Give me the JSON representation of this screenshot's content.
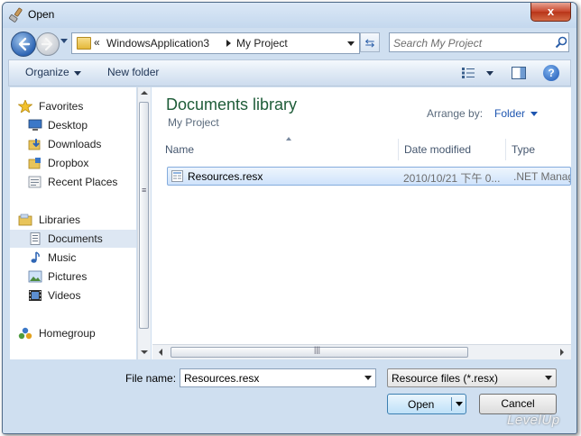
{
  "window": {
    "title": "Open",
    "close_label": "x"
  },
  "navigation": {
    "breadcrumb_prefix": "«",
    "path": [
      "WindowsApplication3",
      "My Project"
    ],
    "refresh_glyph": "⇆",
    "search_placeholder": "Search My Project"
  },
  "toolbar": {
    "organize_label": "Organize",
    "new_folder_label": "New folder"
  },
  "sidebar": {
    "favorites_label": "Favorites",
    "favorites": [
      {
        "label": "Desktop",
        "icon": "desktop-icon"
      },
      {
        "label": "Downloads",
        "icon": "downloads-icon"
      },
      {
        "label": "Dropbox",
        "icon": "dropbox-icon"
      },
      {
        "label": "Recent Places",
        "icon": "recent-places-icon"
      }
    ],
    "libraries_label": "Libraries",
    "libraries": [
      {
        "label": "Documents",
        "icon": "documents-icon",
        "selected": true
      },
      {
        "label": "Music",
        "icon": "music-icon"
      },
      {
        "label": "Pictures",
        "icon": "pictures-icon"
      },
      {
        "label": "Videos",
        "icon": "videos-icon"
      }
    ],
    "homegroup_label": "Homegroup"
  },
  "content": {
    "library_title": "Documents library",
    "library_subtitle": "My Project",
    "arrange_by_label": "Arrange by:",
    "arrange_by_value": "Folder",
    "columns": [
      "Name",
      "Date modified",
      "Type"
    ],
    "files": [
      {
        "name": "Resources.resx",
        "date_modified": "2010/10/21 下午 0...",
        "type": ".NET Manag"
      }
    ]
  },
  "footer": {
    "file_name_label": "File name:",
    "file_name_value": "Resources.resx",
    "file_type_value": "Resource files (*.resx)",
    "open_label": "Open",
    "cancel_label": "Cancel"
  },
  "watermark": "LevelUp",
  "colors": {
    "library_title": "#1e5c38",
    "link_blue": "#1d55b0",
    "selection": "#cfe3fb"
  }
}
